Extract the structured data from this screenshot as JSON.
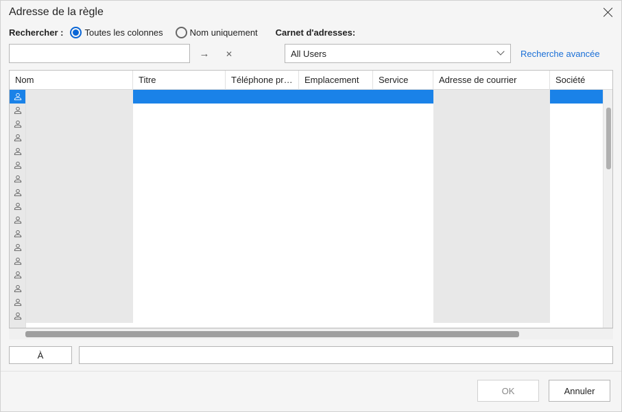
{
  "title": "Adresse de la règle",
  "search": {
    "label": "Rechercher :",
    "option_all": "Toutes les colonnes",
    "option_name": "Nom uniquement",
    "value": ""
  },
  "address_book": {
    "label": "Carnet d'adresses:",
    "selected": "All Users"
  },
  "advanced_link": "Recherche avancée",
  "columns": {
    "nom": "Nom",
    "titre": "Titre",
    "tel": "Téléphone pro...",
    "emplacement": "Emplacement",
    "service": "Service",
    "courrier": "Adresse de courrier",
    "societe": "Société"
  },
  "row_count": 17,
  "to_button": "À",
  "to_value": "",
  "buttons": {
    "ok": "OK",
    "cancel": "Annuler"
  }
}
